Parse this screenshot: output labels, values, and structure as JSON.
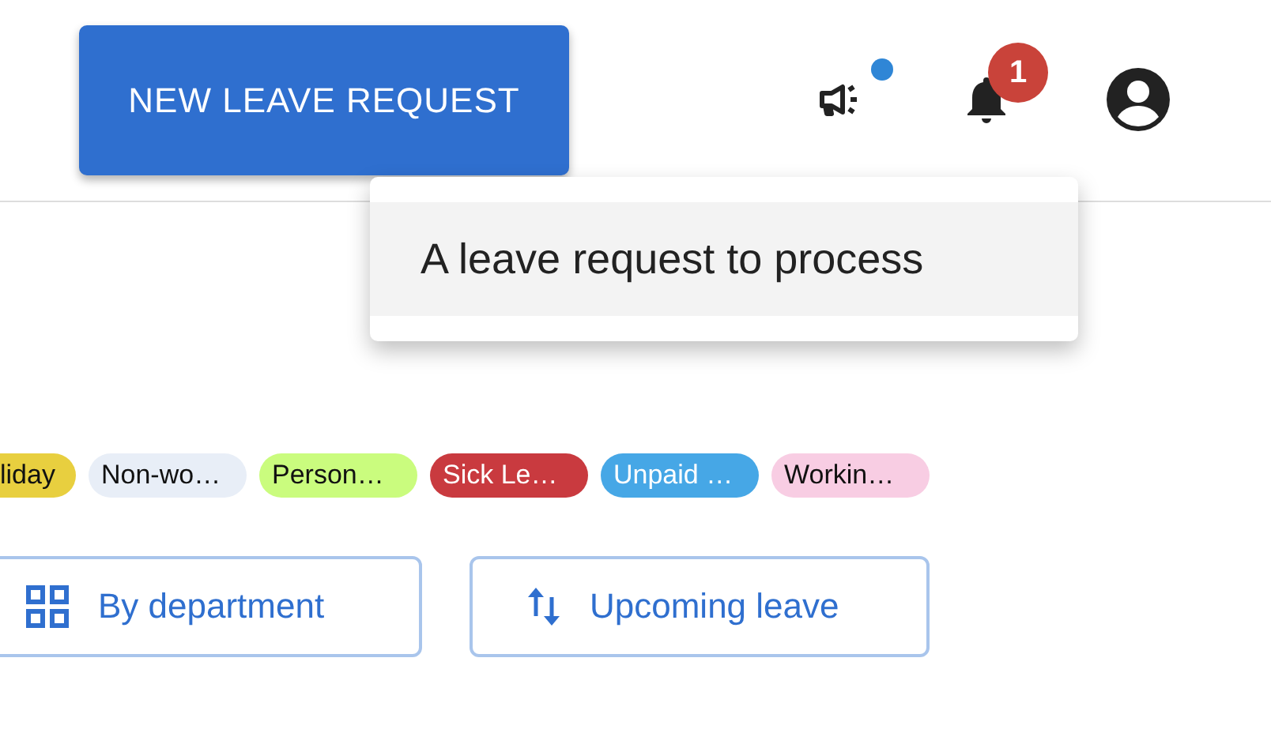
{
  "header": {
    "new_request_button": "NEW LEAVE REQUEST",
    "announcements": {
      "unread": true
    },
    "notifications": {
      "count": "1"
    }
  },
  "menu": {
    "items": [
      {
        "label": "A leave request to process",
        "selected": true
      }
    ]
  },
  "leave_types": [
    {
      "label": "liday",
      "color": "#e8cf3f"
    },
    {
      "label": "Non-wo…",
      "color": "#e8eef7"
    },
    {
      "label": "Person…",
      "color": "#cafc7e"
    },
    {
      "label": "Sick Le…",
      "color": "#c93a3f"
    },
    {
      "label": "Unpaid …",
      "color": "#46a7e6"
    },
    {
      "label": "Workin…",
      "color": "#f8cde3"
    }
  ],
  "view_buttons": [
    {
      "label": "By department",
      "kind": "grid"
    },
    {
      "label": "Upcoming leave",
      "kind": "sort"
    }
  ]
}
